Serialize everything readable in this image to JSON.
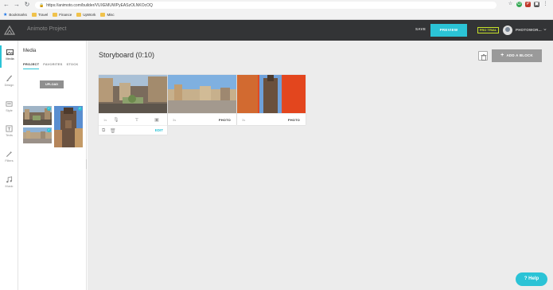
{
  "browser": {
    "url": "https://animoto.com/builder/VUXEMUWPyEASzOLNKOcOQ",
    "bookmarks": [
      {
        "label": "Bookmarks"
      },
      {
        "label": "Travel"
      },
      {
        "label": "Finance"
      },
      {
        "label": "UpWork"
      },
      {
        "label": "Misc"
      }
    ]
  },
  "header": {
    "project_title": "Animoto Project",
    "save_label": "SAVE",
    "preview_label": "PREVIEW",
    "pro_trial_label": "PRO TRIAL",
    "user_label": "PHOTOWOR..."
  },
  "iconbar": {
    "items": [
      {
        "label": "Media",
        "icon": "media-icon"
      },
      {
        "label": "Design",
        "icon": "brush-icon"
      },
      {
        "label": "Style",
        "icon": "style-icon"
      },
      {
        "label": "Texts",
        "icon": "text-icon"
      },
      {
        "label": "Filters",
        "icon": "wand-icon"
      },
      {
        "label": "Music",
        "icon": "music-icon"
      }
    ]
  },
  "panel": {
    "title": "Media",
    "tabs": [
      "PROJECT",
      "FAVORITES",
      "STOCK"
    ],
    "upload_label": "UPLOAD"
  },
  "storyboard": {
    "title": "Storyboard (0:10)",
    "add_block_label": "ADD A BLOCK",
    "blocks": [
      {
        "num": "1s",
        "edit": "EDIT"
      },
      {
        "num": "3s",
        "type": "PHOTO"
      },
      {
        "num": "3s",
        "type": "PHOTO"
      }
    ]
  },
  "help_label": "Help",
  "colors": {
    "accent": "#2bc3d6",
    "header_bg": "#333436",
    "pro_trial": "#c7e22a"
  }
}
